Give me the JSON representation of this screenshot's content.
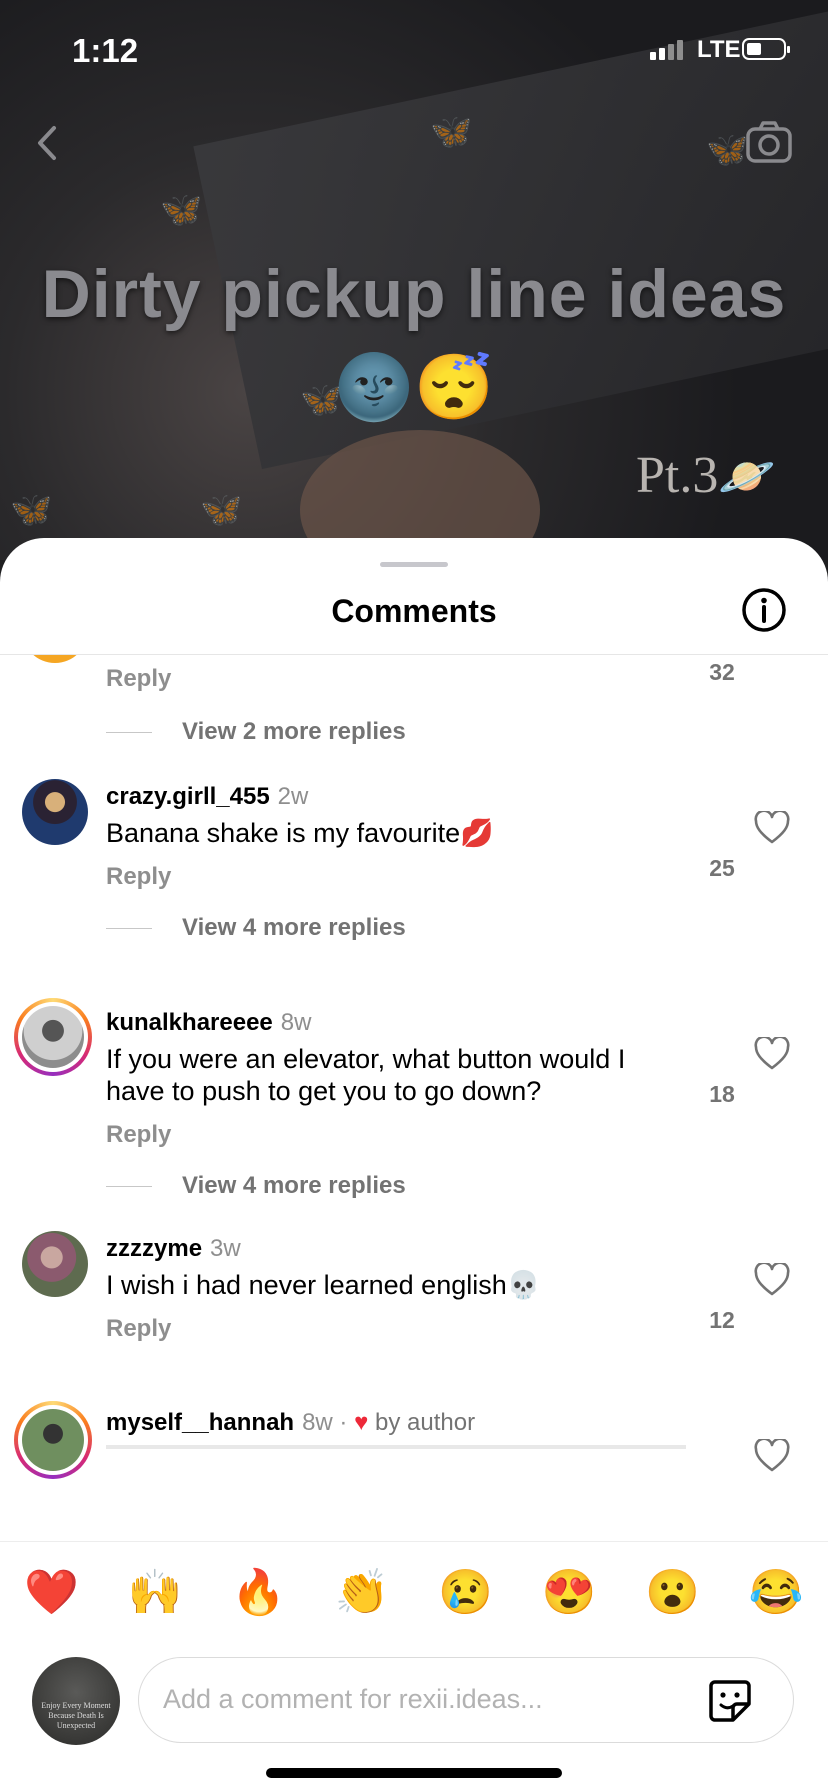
{
  "status_bar": {
    "time": "1:12",
    "network": "LTE"
  },
  "video": {
    "title": "Dirty pickup line ideas",
    "title_emoji": "🌚😴",
    "part_label": "Pt.3",
    "part_emoji": "🪐"
  },
  "sheet": {
    "title": "Comments"
  },
  "top_partial": {
    "reply_label": "Reply",
    "likes": "32",
    "view_more": "View 2 more replies"
  },
  "comments": [
    {
      "username": "crazy.girll_455",
      "age": "2w",
      "text": "Banana shake is my favourite💋",
      "reply_label": "Reply",
      "likes": "25",
      "view_more": "View 4 more replies"
    },
    {
      "username": "kunalkhareeee",
      "age": "8w",
      "text": "If you were an elevator, what button would I have to push to get you to go down?",
      "reply_label": "Reply",
      "likes": "18",
      "view_more": "View 4 more replies"
    },
    {
      "username": "zzzzyme",
      "age": "3w",
      "text": "I wish i had never learned english💀",
      "reply_label": "Reply",
      "likes": "12"
    },
    {
      "username": "myself__hannah",
      "age": "8w ·",
      "liked_by": "by author"
    }
  ],
  "reactions": [
    "❤️",
    "🙌",
    "🔥",
    "👏",
    "😢",
    "😍",
    "😮",
    "😂"
  ],
  "composer": {
    "placeholder": "Add a comment for rexii.ideas...",
    "avatar_text": "Enjoy Every Moment Because Death Is Unexpected"
  }
}
